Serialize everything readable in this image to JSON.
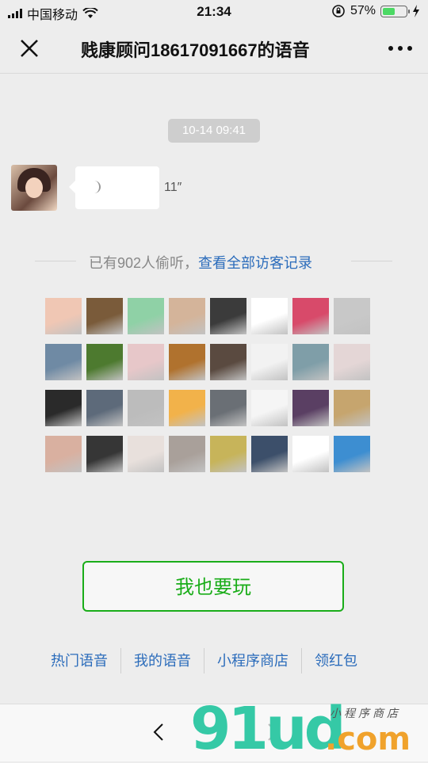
{
  "status_bar": {
    "carrier": "中国移动",
    "time": "21:34",
    "battery_percent": "57%",
    "battery_level": 0.57,
    "icons": [
      "signal-icon",
      "wifi-icon",
      "orientation-lock-icon",
      "battery-icon",
      "charging-icon"
    ]
  },
  "navbar": {
    "title": "贱康顾问18617091667的语音",
    "close_icon": "close-icon",
    "more_icon": "more-icon"
  },
  "chat": {
    "timestamp": "10-14 09:41",
    "duration": "11″"
  },
  "visitors": {
    "prefix": "已有902人偷听，",
    "link": "查看全部访客记录",
    "avatar_colors": [
      "#f0c7b4",
      "#7a5b3a",
      "#8fd1a6",
      "#d4b49a",
      "#3b3b3b",
      "#ffffff",
      "#d84a6a",
      "#c8c8c8",
      "#6f8aa4",
      "#4d7a2f",
      "#e7c7c9",
      "#b0722e",
      "#5a4a40",
      "#f2f2f2",
      "#7f9ea8",
      "#e4d6d6",
      "#2a2a2a",
      "#5d6a7a",
      "#bcbcbc",
      "#f2b24a",
      "#6a6f75",
      "#f5f5f5",
      "#5a3f63",
      "#c6a56e",
      "#d9b0a0",
      "#363636",
      "#e8e0dc",
      "#a9a09a",
      "#c7b45a",
      "#3c4f6a",
      "#ffffff",
      "#3d8ed1"
    ]
  },
  "actions": {
    "play_button": "我也要玩",
    "links": [
      "热门语音",
      "我的语音",
      "小程序商店",
      "领红包"
    ]
  },
  "bottom_bar": {
    "back_icon": "back-arrow-icon",
    "forward_icon": "forward-arrow-icon"
  },
  "watermark": {
    "brand": "91ud",
    "domain": ".com",
    "tagline": "小程序商店"
  },
  "colors": {
    "accent_green": "#1aad19",
    "link_blue": "#2b6cbb",
    "background": "#ededed"
  }
}
